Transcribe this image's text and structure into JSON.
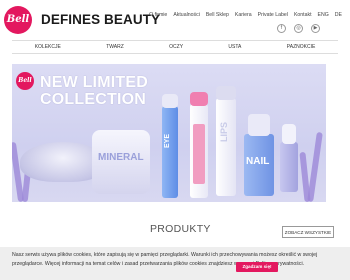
{
  "brand": {
    "logo_text": "Bell",
    "name": "DEFINES BEAUTY"
  },
  "topnav": {
    "items": [
      "O firmie",
      "Aktualności",
      "Bell Sklep",
      "Kariera",
      "Private Label",
      "Kontakt",
      "ENG",
      "DE"
    ]
  },
  "social": {
    "icons": [
      "facebook-icon",
      "instagram-icon",
      "youtube-icon"
    ]
  },
  "categories": [
    "KOLEKCJE",
    "TWARZ",
    "OCZY",
    "USTA",
    "PAZNOKCIE"
  ],
  "hero": {
    "logo_text": "Bell",
    "title_line1": "NEW LIMITED",
    "title_line2": "COLLECTION",
    "product_label_1": "MINERAL",
    "product_label_2": "EYE",
    "product_label_3": "LIPS",
    "product_label_4": "NAIL"
  },
  "products": {
    "heading": "PRODUKTY",
    "see_all": "ZOBACZ WSZYSTKIE"
  },
  "cookie": {
    "text": "Nasz serwis używa plików cookies, które zapisują się w pamięci przeglądarki. Warunki ich przechowywania możesz określić w swojej przeglądarce. Więcej informacji na temat celów i zasad przetwarzania plików cookies znajdziesz w naszej Polityce prywatności.",
    "accept": "Zgadzam się!"
  },
  "colors": {
    "accent": "#e3185f",
    "hero_bg": "#d3d3f0"
  }
}
